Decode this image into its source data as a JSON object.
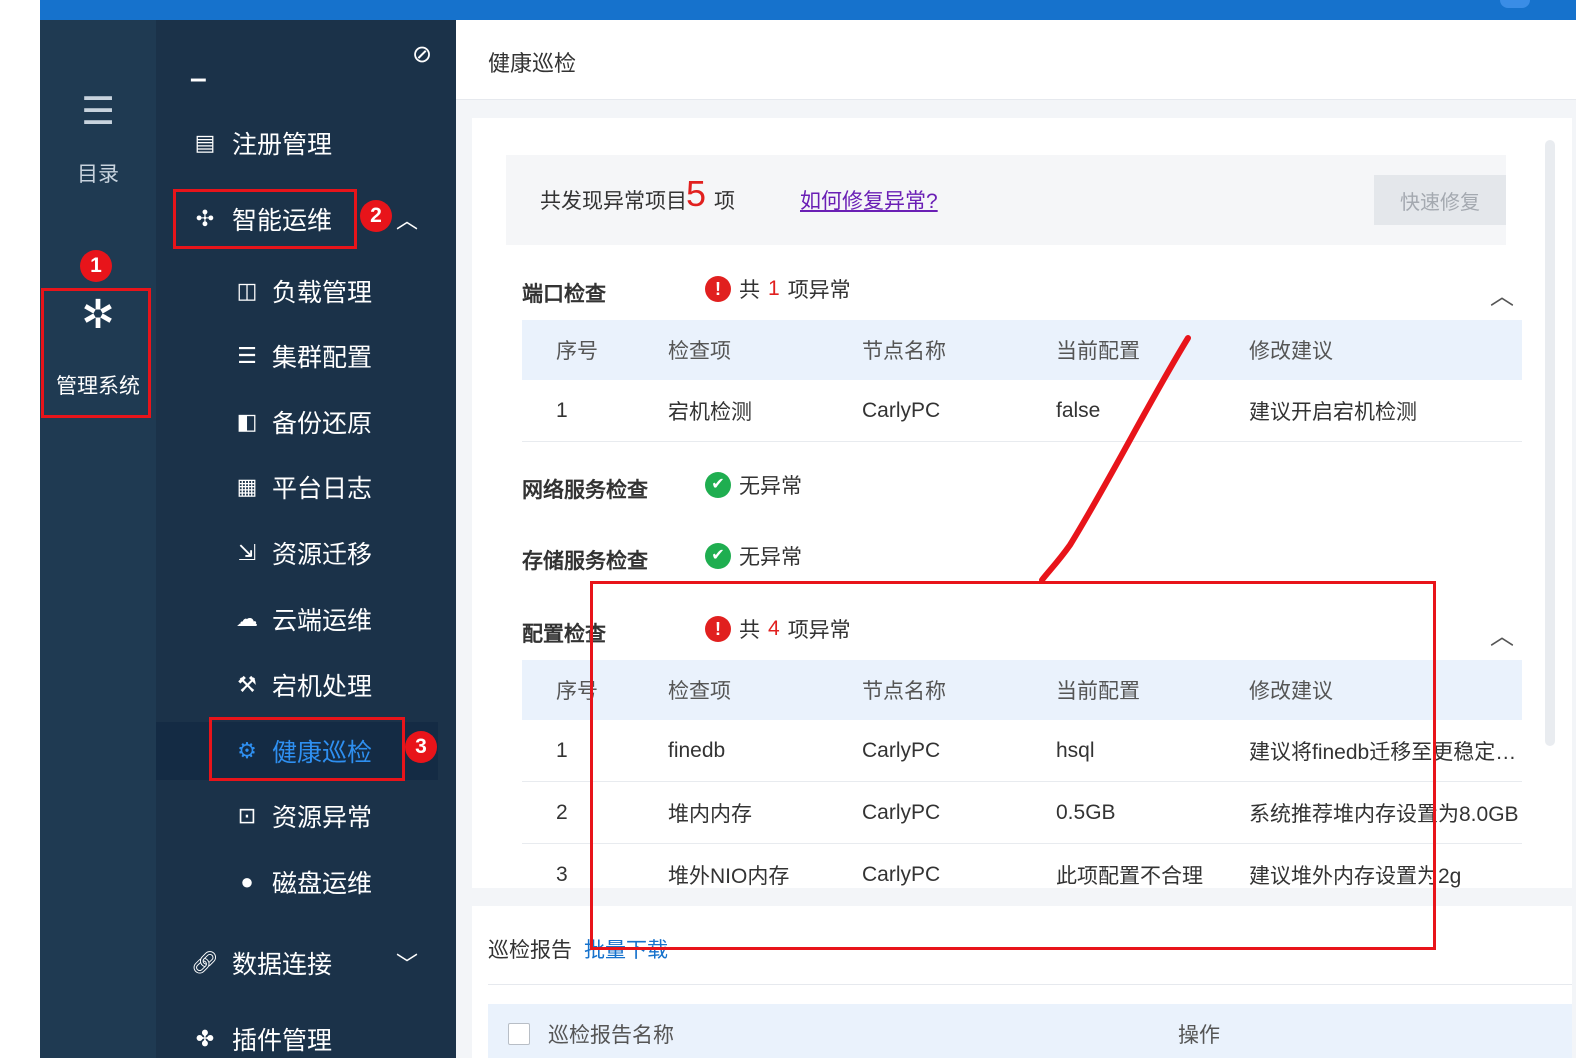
{
  "rail": {
    "catalog_icon": "list-icon",
    "catalog_label": "目录",
    "admin_icon": "gear-icon",
    "admin_label": "管理系统"
  },
  "submenu": {
    "collapse_glyph": "–",
    "pin_icon": "unpin-icon",
    "items": [
      {
        "label": "注册管理",
        "icon": "register-icon"
      },
      {
        "label": "智能运维",
        "icon": "ops-icon"
      },
      {
        "label": "负载管理",
        "icon": "load-icon"
      },
      {
        "label": "集群配置",
        "icon": "cluster-icon"
      },
      {
        "label": "备份还原",
        "icon": "backup-icon"
      },
      {
        "label": "平台日志",
        "icon": "log-icon"
      },
      {
        "label": "资源迁移",
        "icon": "migrate-icon"
      },
      {
        "label": "云端运维",
        "icon": "cloud-ops-icon"
      },
      {
        "label": "宕机处理",
        "icon": "wrench-icon"
      },
      {
        "label": "健康巡检",
        "icon": "gear-icon"
      },
      {
        "label": "资源异常",
        "icon": "alert-icon"
      },
      {
        "label": "磁盘运维",
        "icon": "disk-icon"
      },
      {
        "label": "数据连接",
        "icon": "link-icon"
      },
      {
        "label": "插件管理",
        "icon": "plugin-icon"
      }
    ]
  },
  "page": {
    "title": "健康巡检"
  },
  "summary": {
    "prefix": "共发现异常项目",
    "count": "5",
    "unit": "项",
    "help_link": "如何修复异常?",
    "fix_button": "快速修复"
  },
  "sections": {
    "port": {
      "title": "端口检查",
      "status_prefix": "共",
      "count": "1",
      "status_suffix": "项异常",
      "rows": [
        {
          "no": "1",
          "item": "宕机检测",
          "node": "CarlyPC",
          "config": "false",
          "advice": "建议开启宕机检测"
        }
      ]
    },
    "network": {
      "title": "网络服务检查",
      "status": "无异常"
    },
    "storage": {
      "title": "存储服务检查",
      "status": "无异常"
    },
    "config": {
      "title": "配置检查",
      "status_prefix": "共",
      "count": "4",
      "status_suffix": "项异常",
      "rows": [
        {
          "no": "1",
          "item": "finedb",
          "node": "CarlyPC",
          "config": "hsql",
          "advice": "建议将finedb迁移至更稳定的外部数据库"
        },
        {
          "no": "2",
          "item": "堆内内存",
          "node": "CarlyPC",
          "config": "0.5GB",
          "advice": "系统推荐堆内存设置为8.0GB"
        },
        {
          "no": "3",
          "item": "堆外NIO内存",
          "node": "CarlyPC",
          "config": "此项配置不合理",
          "advice": "建议堆外内存设置为2g"
        }
      ]
    }
  },
  "table_headers": {
    "no": "序号",
    "item": "检查项",
    "node": "节点名称",
    "config": "当前配置",
    "advice": "修改建议"
  },
  "report": {
    "title": "巡检报告",
    "download": "批量下载",
    "name_header": "巡检报告名称",
    "action_header": "操作"
  },
  "annotations": [
    "1",
    "2",
    "3"
  ],
  "colors": {
    "accent": "#1672cc",
    "error": "#e1201f",
    "ok": "#1fae50",
    "annotation": "#e8141a"
  }
}
